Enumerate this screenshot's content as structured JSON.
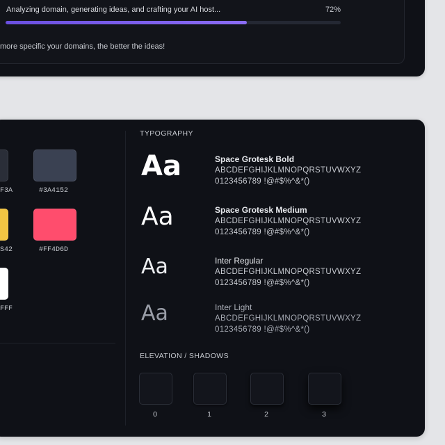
{
  "progress": {
    "status_text": "Analyzing domain, generating ideas, and crafting your AI host...",
    "percent_label": "72%",
    "percent_value": 72,
    "fill_color": "#7357eb",
    "hint_text": "more specific your domains, the better the ideas!"
  },
  "palette": {
    "swatches": [
      {
        "color": "#2a2e38",
        "label": "F3A"
      },
      {
        "color": "#3A4152",
        "label": "#3A4152"
      },
      {
        "color": "#f2c543",
        "label": "S42"
      },
      {
        "color": "#FF4D6D",
        "label": "#FF4D6D"
      },
      {
        "color": "#ffffff",
        "label": "FFF"
      }
    ]
  },
  "typography": {
    "title": "TYPOGRAPHY",
    "sample": "Aa",
    "fonts": [
      {
        "name": "Space Grotesk Bold",
        "uppercase": "ABCDEFGHIJKLMNOPQRSTUVWXYZ",
        "digits": "0123456789 !@#$%^&*()"
      },
      {
        "name": "Space Grotesk Medium",
        "uppercase": "ABCDEFGHIJKLMNOPQRSTUVWXYZ",
        "digits": "0123456789 !@#$%^&*()"
      },
      {
        "name": "Inter Regular",
        "uppercase": "ABCDEFGHIJKLMNOPQRSTUVWXYZ",
        "digits": "0123456789 !@#$%^&*()"
      },
      {
        "name": "Inter Light",
        "uppercase": "ABCDEFGHIJKLMNOPQRSTUVWXYZ",
        "digits": "0123456789 !@#$%^&*()"
      }
    ]
  },
  "elevation": {
    "title": "ELEVATION / SHADOWS",
    "levels": [
      "0",
      "1",
      "2",
      "3"
    ]
  }
}
